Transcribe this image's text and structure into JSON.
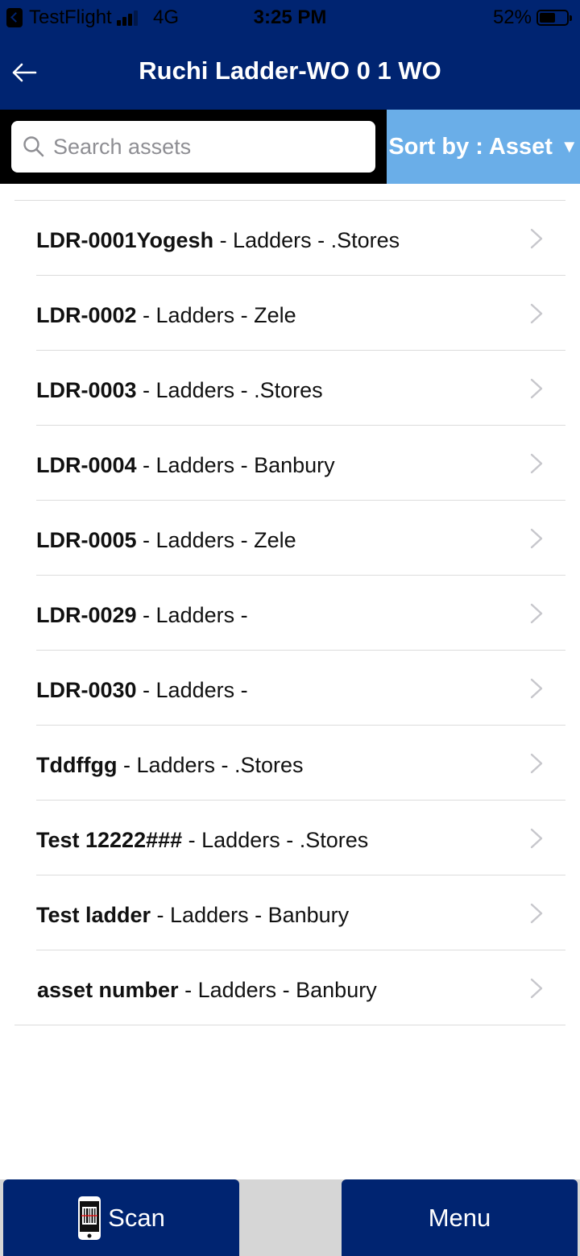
{
  "status_bar": {
    "carrier": "TestFlight",
    "network": "4G",
    "time": "3:25 PM",
    "battery": "52%",
    "battery_level": 0.52
  },
  "nav": {
    "title": "Ruchi Ladder-WO 0 1 WO"
  },
  "search": {
    "placeholder": "Search assets",
    "value": ""
  },
  "sort": {
    "label": "Sort by : Asset",
    "arrow": "▼"
  },
  "assets": [
    {
      "id": "LDR-0001Yogesh",
      "details": " - Ladders - .Stores"
    },
    {
      "id": "LDR-0002",
      "details": " - Ladders - Zele"
    },
    {
      "id": "LDR-0003",
      "details": " - Ladders - .Stores"
    },
    {
      "id": "LDR-0004",
      "details": " - Ladders - Banbury"
    },
    {
      "id": "LDR-0005",
      "details": " - Ladders - Zele"
    },
    {
      "id": "LDR-0029",
      "details": " - Ladders - "
    },
    {
      "id": "LDR-0030",
      "details": " - Ladders - "
    },
    {
      "id": "Tddffgg",
      "details": " - Ladders - .Stores"
    },
    {
      "id": "Test 12222###",
      "details": " - Ladders - .Stores"
    },
    {
      "id": "Test ladder",
      "details": " - Ladders - Banbury"
    },
    {
      "id": "asset number",
      "details": " - Ladders - Banbury"
    }
  ],
  "bottom": {
    "scan_label": "Scan",
    "menu_label": "Menu"
  },
  "colors": {
    "primary": "#002471",
    "sort_bg": "#6aaee8",
    "divider": "#dcdcdc"
  }
}
